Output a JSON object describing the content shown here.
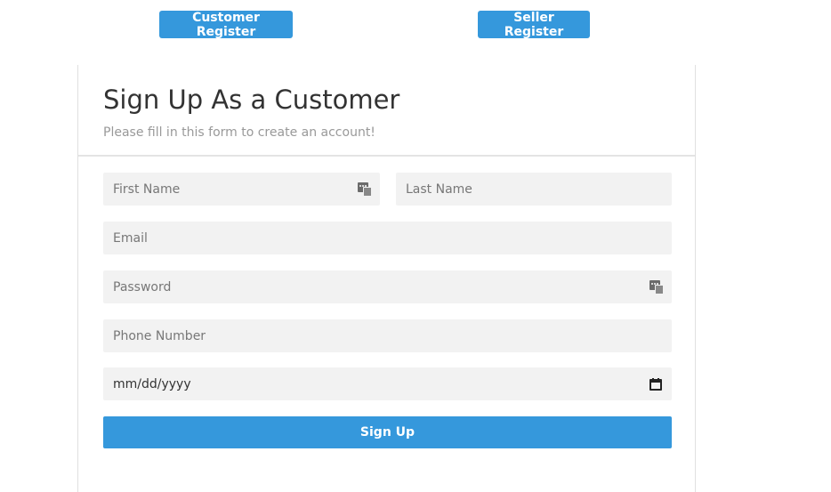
{
  "nav": {
    "customer_register": "Customer Register",
    "seller_register": "Seller Register"
  },
  "form": {
    "title": "Sign Up As a Customer",
    "subtitle": "Please fill in this form to create an account!",
    "first_name_placeholder": "First Name",
    "last_name_placeholder": "Last Name",
    "email_placeholder": "Email",
    "password_placeholder": "Password",
    "phone_placeholder": "Phone Number",
    "date_placeholder": "mm/dd/yyyy",
    "submit_label": "Sign Up"
  },
  "icons": {
    "first_name_field_icon": "password-manager-key-icon",
    "password_field_icon": "password-manager-key-icon",
    "date_field_icon": "calendar-icon"
  },
  "colors": {
    "accent": "#3598dc",
    "field_background": "#f2f2f2",
    "placeholder_text": "#777777",
    "title_text": "#333333",
    "subtitle_text": "#999999"
  }
}
